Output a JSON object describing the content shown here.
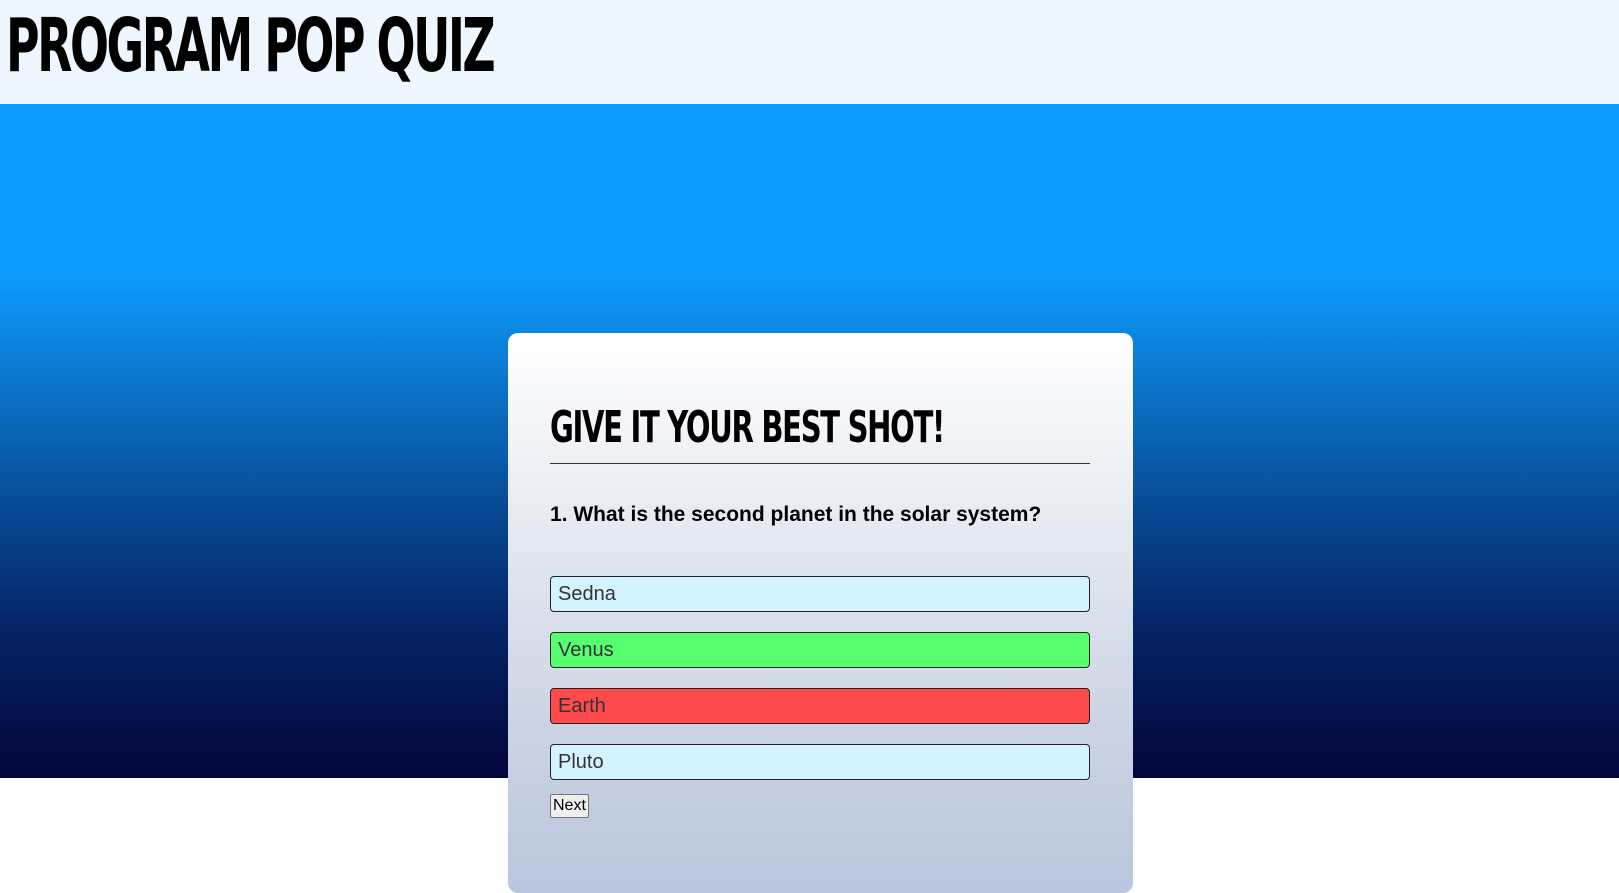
{
  "header": {
    "title": "PROGRAM POP QUIZ"
  },
  "quiz": {
    "heading": "GIVE IT YOUR BEST SHOT!",
    "question": "1. What is the second planet in the solar system?",
    "options": [
      {
        "label": "Sedna",
        "state": "neutral"
      },
      {
        "label": "Venus",
        "state": "correct"
      },
      {
        "label": "Earth",
        "state": "wrong"
      },
      {
        "label": "Pluto",
        "state": "neutral"
      }
    ],
    "next_label": "Next"
  },
  "colors": {
    "header_bg": "#eef7ff",
    "gradient_top": "#0d9cff",
    "gradient_bottom": "#03053a",
    "option_neutral": "#d3f3ff",
    "option_correct": "#57fe6f",
    "option_wrong": "#ff4a4c"
  }
}
